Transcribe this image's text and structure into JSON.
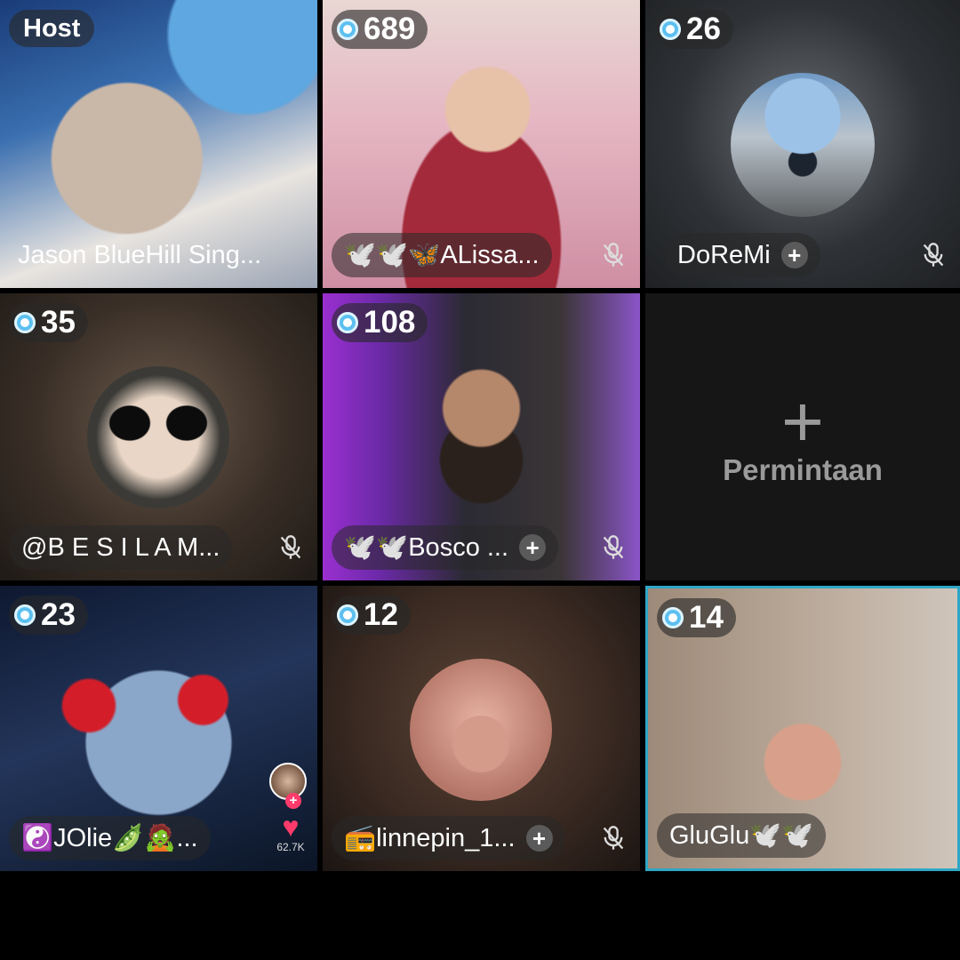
{
  "host_label": "Host",
  "request": {
    "label": "Permintaan"
  },
  "tiles": [
    {
      "name": "Jason BlueHill Sing..."
    },
    {
      "count": "689",
      "name": "🕊️🕊️🦋ALissa..."
    },
    {
      "count": "26",
      "name": "DoReMi"
    },
    {
      "count": "35",
      "name": "@B E S I L A M..."
    },
    {
      "count": "108",
      "name": "🕊️🕊️Bosco ..."
    },
    {
      "count": "23",
      "name": "☯️JOlie🫛🧟..."
    },
    {
      "count": "12",
      "name": "📻linnepin_1..."
    },
    {
      "count": "14",
      "name": "GluGlu🕊️🕊️"
    }
  ],
  "likes": {
    "count": "62.7K"
  },
  "colors": {
    "badge_gem": "#5cc0f0",
    "active_border": "#2fa6c6",
    "heart": "#ff3b6b"
  },
  "icons": [
    "mic-muted-icon",
    "plus-icon",
    "heart-icon",
    "gem-icon"
  ]
}
